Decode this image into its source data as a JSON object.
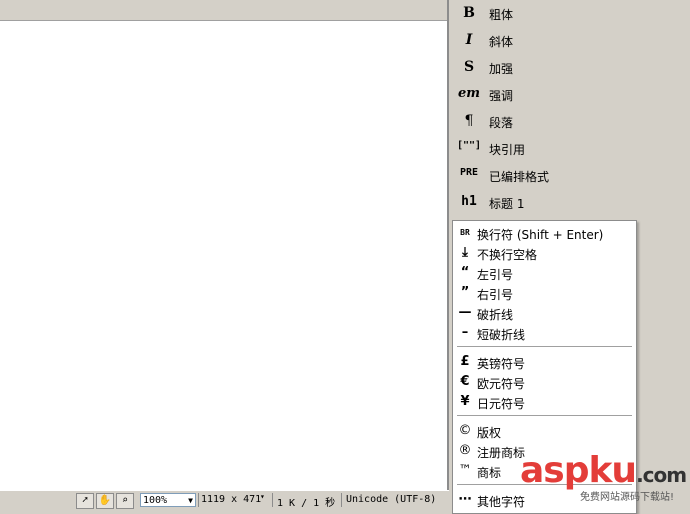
{
  "panel": {
    "items": [
      {
        "icon": "B",
        "label": "粗体"
      },
      {
        "icon": "I",
        "label": "斜体"
      },
      {
        "icon": "S",
        "label": "加强"
      },
      {
        "icon": "em",
        "label": "强调"
      },
      {
        "icon": "¶",
        "label": "段落"
      },
      {
        "icon": "[\"\"]",
        "label": "块引用"
      },
      {
        "icon": "PRE",
        "label": "已编排格式"
      },
      {
        "icon": "h1",
        "label": "标题 1"
      }
    ]
  },
  "menu": {
    "items": [
      {
        "icon": "BR",
        "label": "换行符 (Shift + Enter)"
      },
      {
        "icon": "⤓",
        "label": "不换行空格"
      },
      {
        "icon": "“",
        "label": "左引号"
      },
      {
        "icon": "”",
        "label": "右引号"
      },
      {
        "icon": "—",
        "label": "破折线"
      },
      {
        "icon": "–",
        "label": "短破折线"
      },
      {
        "icon": "£",
        "label": "英镑符号"
      },
      {
        "icon": "€",
        "label": "欧元符号"
      },
      {
        "icon": "¥",
        "label": "日元符号"
      },
      {
        "icon": "©",
        "label": "版权"
      },
      {
        "icon": "®",
        "label": "注册商标"
      },
      {
        "icon": "™",
        "label": "商标"
      },
      {
        "icon": "⋯",
        "label": "其他字符"
      }
    ]
  },
  "statusbar": {
    "zoom": "100%",
    "dimensions": "1119 x 471",
    "size_time": "1 K / 1 秒",
    "encoding": "Unicode (UTF-8)"
  },
  "watermark": {
    "brand": "aspku",
    "domain": ".com",
    "tagline": "免费网站源码下载站!"
  }
}
